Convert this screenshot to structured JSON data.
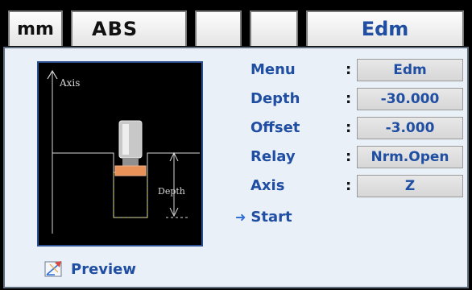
{
  "header": {
    "tabs": [
      {
        "label": "mm"
      },
      {
        "label": "ABS"
      },
      {
        "label": ""
      },
      {
        "label": ""
      },
      {
        "label": "Edm"
      }
    ]
  },
  "diagram": {
    "axis_label": "Axis",
    "depth_label": "Depth",
    "colors": {
      "background": "#000000",
      "line": "#d9d9d9",
      "electrode": "#c8c8c8",
      "tip": "#e8925a",
      "hole_dash": "#e6df6a"
    }
  },
  "params": [
    {
      "label": "Menu",
      "value": "Edm"
    },
    {
      "label": "Depth",
      "value": "-30.000"
    },
    {
      "label": "Offset",
      "value": "-3.000"
    },
    {
      "label": "Relay",
      "value": "Nrm.Open"
    },
    {
      "label": "Axis",
      "value": "Z"
    }
  ],
  "colon": ":",
  "start": {
    "label": "Start",
    "icon": "arrow-right-icon"
  },
  "preview_button": {
    "label": "Preview",
    "icon": "preview-icon"
  },
  "colors": {
    "accent": "#1f4ea2",
    "panel_bg": "#e9f0f8",
    "value_box": "#dcdcdc"
  }
}
